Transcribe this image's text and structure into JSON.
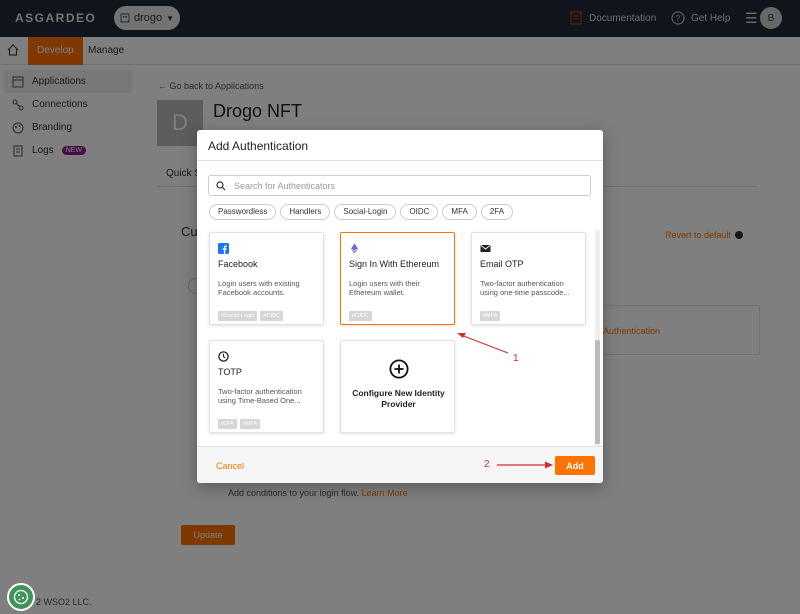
{
  "header": {
    "logo": "ASGARDEO",
    "org": "drogo",
    "documentation": "Documentation",
    "get_help": "Get Help",
    "avatar_initial": "B"
  },
  "subnav": {
    "develop": "Develop",
    "manage": "Manage"
  },
  "sidebar": {
    "items": [
      {
        "label": "Applications",
        "icon": "applications-icon"
      },
      {
        "label": "Connections",
        "icon": "connections-icon"
      },
      {
        "label": "Branding",
        "icon": "branding-icon"
      },
      {
        "label": "Logs",
        "icon": "logs-icon",
        "badge": "NEW"
      }
    ]
  },
  "main": {
    "back_link": "Go back to Applications",
    "app_initial": "D",
    "app_title": "Drogo NFT",
    "tab_quick": "Quick S",
    "section_heading": "Cu",
    "revert": "Revert to default",
    "auth_text": "Authentication",
    "condition_text": "Add conditions to your login flow.",
    "learn_more": "Learn More",
    "update": "Update"
  },
  "footer": {
    "text": "2 WSO2 LLC."
  },
  "modal": {
    "title": "Add Authentication",
    "search_placeholder": "Search for Authenticators",
    "chips": [
      "Passwordless",
      "Handlers",
      "Social-Login",
      "OIDC",
      "MFA",
      "2FA"
    ],
    "cards": [
      {
        "title": "Facebook",
        "description": "Login users with existing Facebook accounts.",
        "tags": [
          "#Social-Login",
          "#OIDC"
        ],
        "icon": "facebook-icon",
        "selected": false
      },
      {
        "title": "Sign In With Ethereum",
        "description": "Login users with their Ethereum wallet.",
        "tags": [
          "#OIDC"
        ],
        "icon": "ethereum-icon",
        "selected": true
      },
      {
        "title": "Email OTP",
        "description": "Two-factor authentication using one-time passcode...",
        "tags": [
          "#MFA"
        ],
        "icon": "envelope-icon",
        "selected": false
      },
      {
        "title": "TOTP",
        "description": "Two-factor authentication using Time-Based One...",
        "tags": [
          "#2FA",
          "#MFA"
        ],
        "icon": "clock-icon",
        "selected": false
      },
      {
        "title": "Configure New Identity Provider",
        "icon": "plus-circle-icon"
      }
    ],
    "cancel": "Cancel",
    "add": "Add"
  },
  "annotations": {
    "one": "1",
    "two": "2"
  },
  "colors": {
    "accent": "#ff7300",
    "header_bg": "#1f2a36",
    "annotation": "#d32f2f"
  }
}
